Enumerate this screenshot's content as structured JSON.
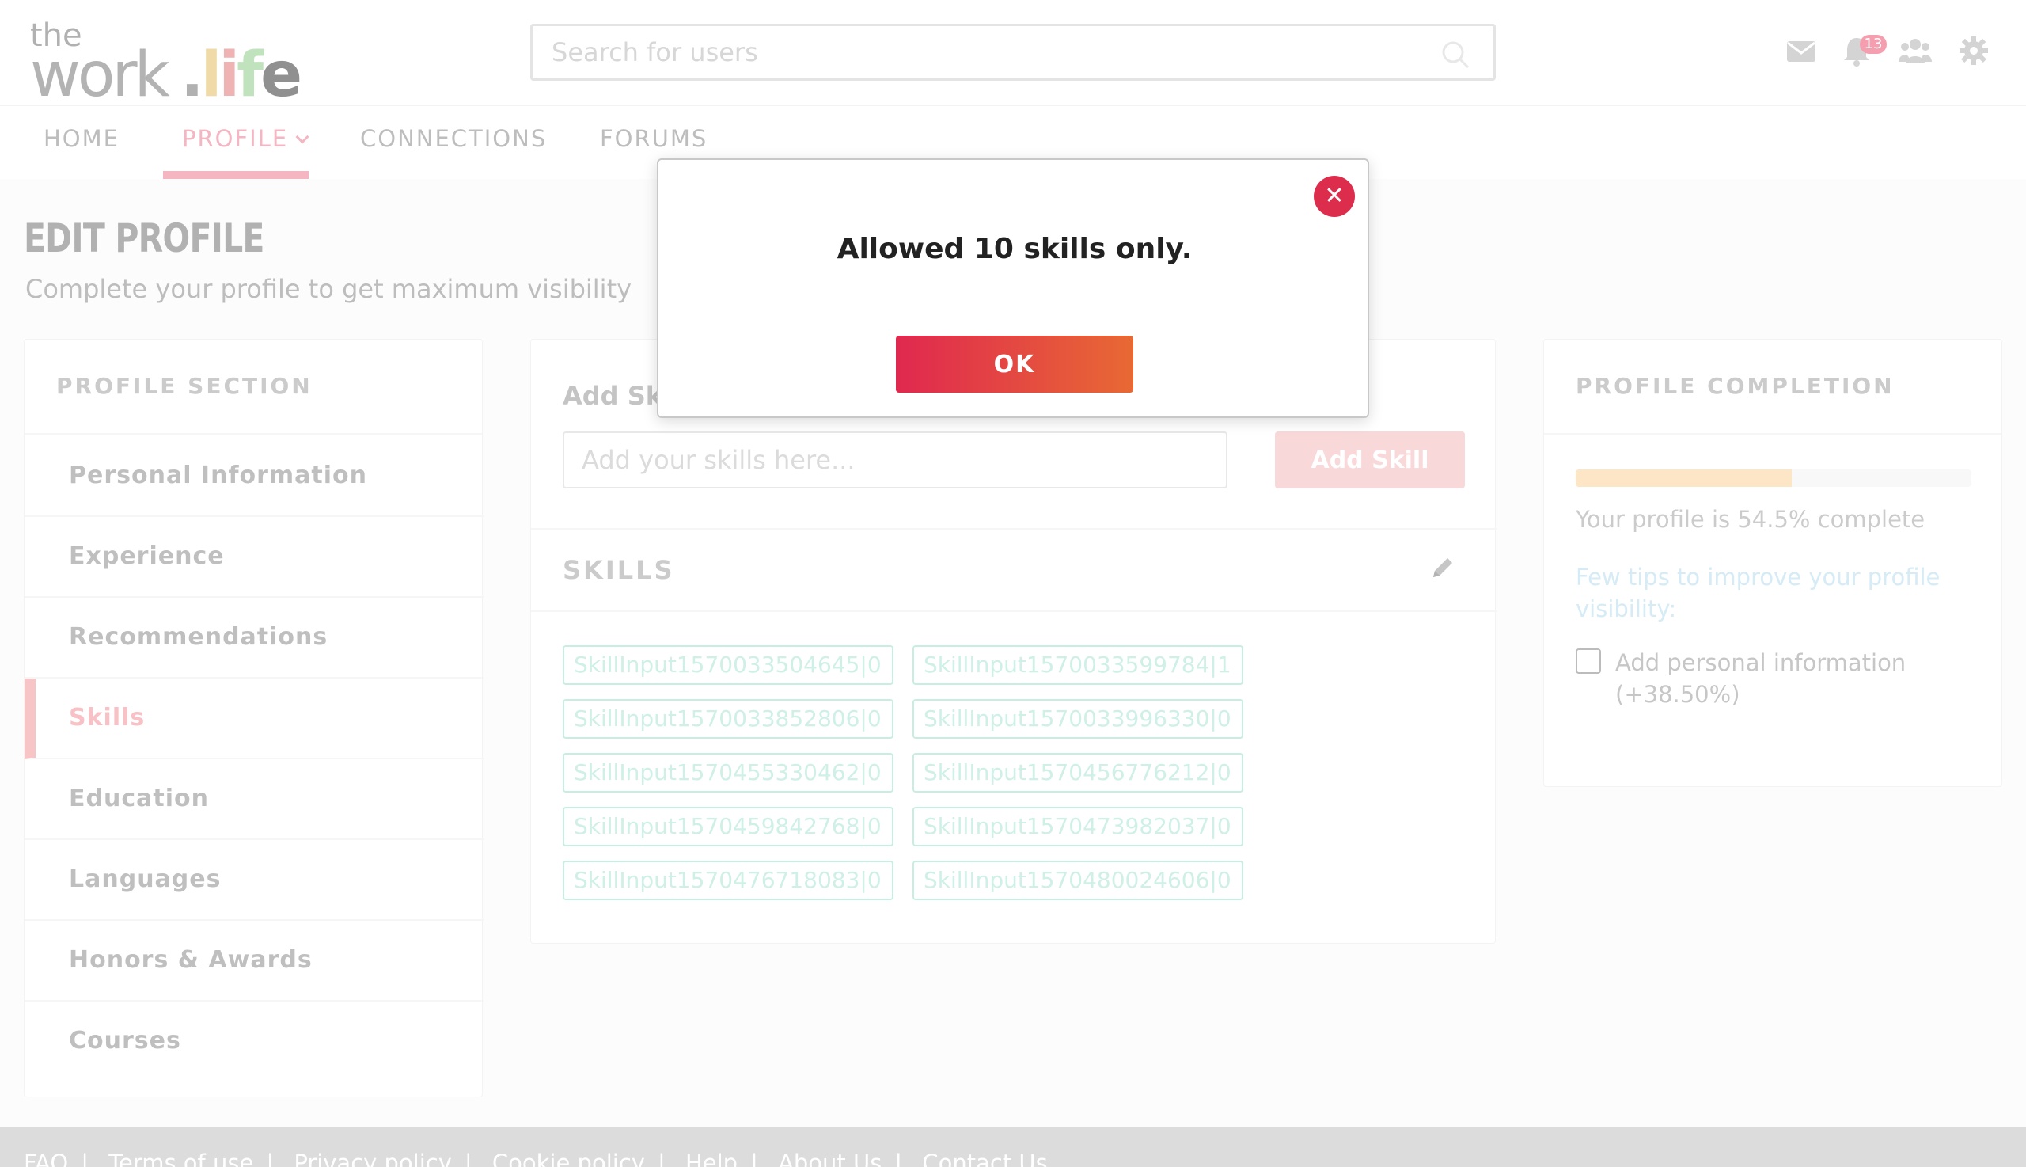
{
  "header": {
    "logo": {
      "the": "the",
      "work": "work",
      "dot": ".",
      "life": [
        "l",
        "i",
        "f",
        "e"
      ]
    },
    "search_placeholder": "Search for users",
    "notification_count": "13",
    "icons": [
      "mail-icon",
      "bell-icon",
      "users-icon",
      "gear-icon"
    ]
  },
  "nav": {
    "tabs": [
      {
        "label": "HOME"
      },
      {
        "label": "PROFILE"
      },
      {
        "label": "CONNECTIONS"
      },
      {
        "label": "FORUMS"
      }
    ],
    "active": "PROFILE"
  },
  "page": {
    "title": "EDIT PROFILE",
    "subtitle": "Complete your profile to get maximum visibility"
  },
  "sidebar": {
    "title": "PROFILE SECTION",
    "items": [
      {
        "label": "Personal Information"
      },
      {
        "label": "Experience"
      },
      {
        "label": "Recommendations"
      },
      {
        "label": "Skills"
      },
      {
        "label": "Education"
      },
      {
        "label": "Languages"
      },
      {
        "label": "Honors & Awards"
      },
      {
        "label": "Courses"
      }
    ],
    "active": "Skills"
  },
  "skills_panel": {
    "add_title": "Add Skills",
    "input_placeholder": "Add your skills here...",
    "add_button": "Add Skill",
    "skills_title": "SKILLS",
    "skills": [
      "SkillInput1570033504645|0",
      "SkillInput1570033599784|1",
      "SkillInput1570033852806|0",
      "SkillInput1570033996330|0",
      "SkillInput1570455330462|0",
      "SkillInput1570456776212|0",
      "SkillInput1570459842768|0",
      "SkillInput1570473982037|0",
      "SkillInput1570476718083|0",
      "SkillInput1570480024606|0"
    ]
  },
  "completion": {
    "title": "PROFILE COMPLETION",
    "percent": 54.5,
    "text": "Your profile is 54.5% complete",
    "tips": "Few tips to improve your profile visibility:",
    "checkbox_label": "Add personal information (+38.50%)",
    "checkbox_checked": false,
    "colors": {
      "progress_fill": "#fbd9a6",
      "tips": "#bfe0f2"
    }
  },
  "footer": {
    "links": [
      "FAQ",
      "Terms of use",
      "Privacy policy",
      "Cookie policy",
      "Help",
      "About Us",
      "Contact Us"
    ]
  },
  "modal": {
    "message": "Allowed 10 skills only.",
    "ok_label": "OK",
    "close_label": "✕",
    "colors": {
      "accent_start": "#e0284f",
      "accent_end": "#e86934"
    }
  }
}
